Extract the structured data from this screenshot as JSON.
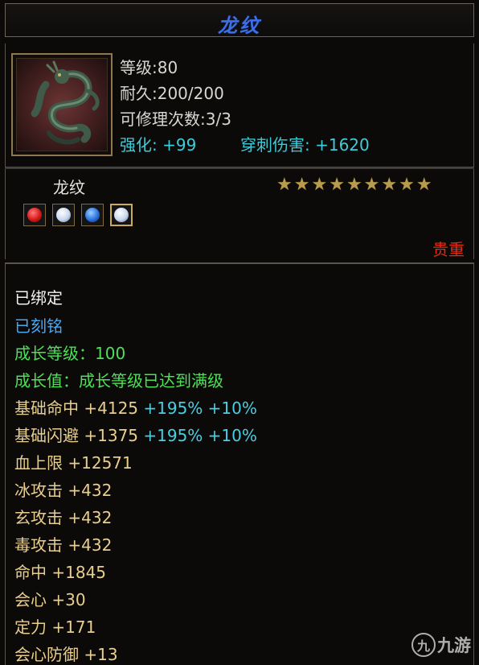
{
  "title": "龙纹",
  "item": {
    "icon": "dragon-seal-icon",
    "stats": {
      "level": "等级:80",
      "durability": "耐久:200/200",
      "repair": "可修理次数:3/3",
      "enhance": "强化: +99",
      "pierce": "穿刺伤害: +1620"
    },
    "name": "龙纹",
    "stars": [
      "★",
      "★",
      "★",
      "★",
      "★",
      "★",
      "★",
      "★",
      "★"
    ],
    "gems": [
      {
        "icon": "red-gem-icon",
        "color": "#d81818"
      },
      {
        "icon": "white-gem-icon",
        "color": "#c8d6ee"
      },
      {
        "icon": "blue-gem-icon",
        "color": "#2a72e0"
      },
      {
        "icon": "white-gem-icon",
        "color": "#c8d6ee"
      }
    ],
    "rarity": "贵重"
  },
  "attrs": {
    "bound": "已绑定",
    "engraved": "已刻铭",
    "growth_level": "成长等级：100",
    "growth_value": "成长值：成长等级已达到满级",
    "base_hit": {
      "label": "基础命中",
      "value": "+4125",
      "bonus1": "+195%",
      "bonus2": "+10%"
    },
    "base_dodge": {
      "label": "基础闪避",
      "value": "+1375",
      "bonus1": "+195%",
      "bonus2": "+10%"
    },
    "hp": "血上限 +12571",
    "ice_attack": "冰攻击 +432",
    "mystic_attack": "玄攻击 +432",
    "poison_attack": "毒攻击 +432",
    "hit": "命中 +1845",
    "crit": "会心 +30",
    "focus": "定力 +171",
    "crit_defense": "会心防御 +13"
  },
  "watermark": {
    "logo": "九",
    "text": "九游"
  },
  "colors": {
    "title": "#3d6fe6",
    "cyan": "#3fcbd7",
    "green": "#4ee056",
    "gold": "#e9ce8c",
    "rarity": "#e62a12"
  }
}
